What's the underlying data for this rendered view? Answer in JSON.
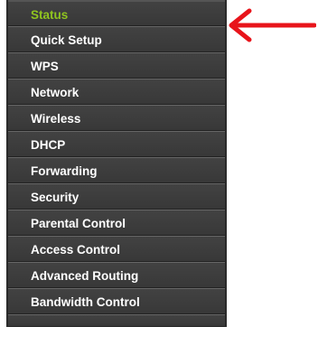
{
  "sidebar": {
    "items": [
      {
        "label": "Status",
        "active": true
      },
      {
        "label": "Quick Setup",
        "active": false
      },
      {
        "label": "WPS",
        "active": false
      },
      {
        "label": "Network",
        "active": false
      },
      {
        "label": "Wireless",
        "active": false
      },
      {
        "label": "DHCP",
        "active": false
      },
      {
        "label": "Forwarding",
        "active": false
      },
      {
        "label": "Security",
        "active": false
      },
      {
        "label": "Parental Control",
        "active": false
      },
      {
        "label": "Access Control",
        "active": false
      },
      {
        "label": "Advanced Routing",
        "active": false
      },
      {
        "label": "Bandwidth Control",
        "active": false
      }
    ]
  },
  "annotation": {
    "icon": "red-arrow-left-icon",
    "color": "#e8141b"
  },
  "colors": {
    "menu_bg": "#3c3c3c",
    "active_text": "#8fc41f",
    "text": "#ffffff"
  }
}
